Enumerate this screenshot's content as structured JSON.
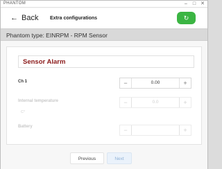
{
  "window": {
    "title": "PHANTOM"
  },
  "header": {
    "back_label": "Back",
    "page_title": "Extra configurations",
    "refresh_icon": "refresh-icon",
    "accent": "#3bb543"
  },
  "phantom_type": "Phantom type: EINRPM - RPM Sensor",
  "section": {
    "title": "Sensor Alarm",
    "title_color": "#8b1a1a"
  },
  "rows": [
    {
      "label": "Ch 1",
      "sub": "",
      "value": "0.00",
      "enabled": true
    },
    {
      "label": "Internal temperature",
      "sub": "C°",
      "value": "0.0",
      "enabled": false
    },
    {
      "label": "Battery",
      "sub": "",
      "value": "",
      "enabled": false
    }
  ],
  "footer": {
    "previous_label": "Previous",
    "next_label": "Next"
  }
}
